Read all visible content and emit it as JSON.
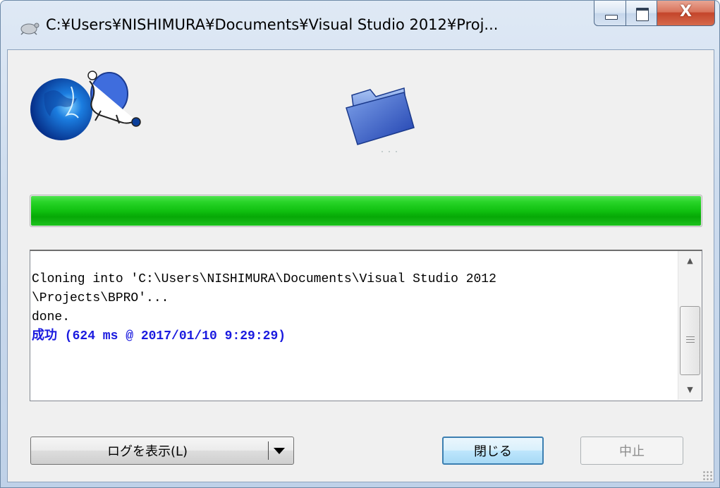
{
  "window": {
    "title": "C:¥Users¥NISHIMURA¥Documents¥Visual Studio 2012¥Proj..."
  },
  "caption_buttons": {
    "minimize_icon": "minimize-icon",
    "maximize_icon": "maximize-icon",
    "close_glyph": "X"
  },
  "progress": {
    "value": 1.0,
    "color": "#10c010"
  },
  "log": {
    "lines": [
      "",
      "Cloning into 'C:\\Users\\NISHIMURA\\Documents\\Visual Studio 2012",
      "\\Projects\\BPRO'...",
      "done.",
      ""
    ],
    "success_label": "成功",
    "success_detail": "(624 ms @ 2017/01/10 9:29:29)",
    "success_color": "#1a1adf"
  },
  "buttons": {
    "show_log": "ログを表示(L)",
    "close": "閉じる",
    "abort": "中止"
  },
  "icons": {
    "app": "tortoisegit-icon",
    "globe": "globe-turtle-icon",
    "folder": "folder-icon",
    "dropdown": "chevron-down-icon"
  }
}
